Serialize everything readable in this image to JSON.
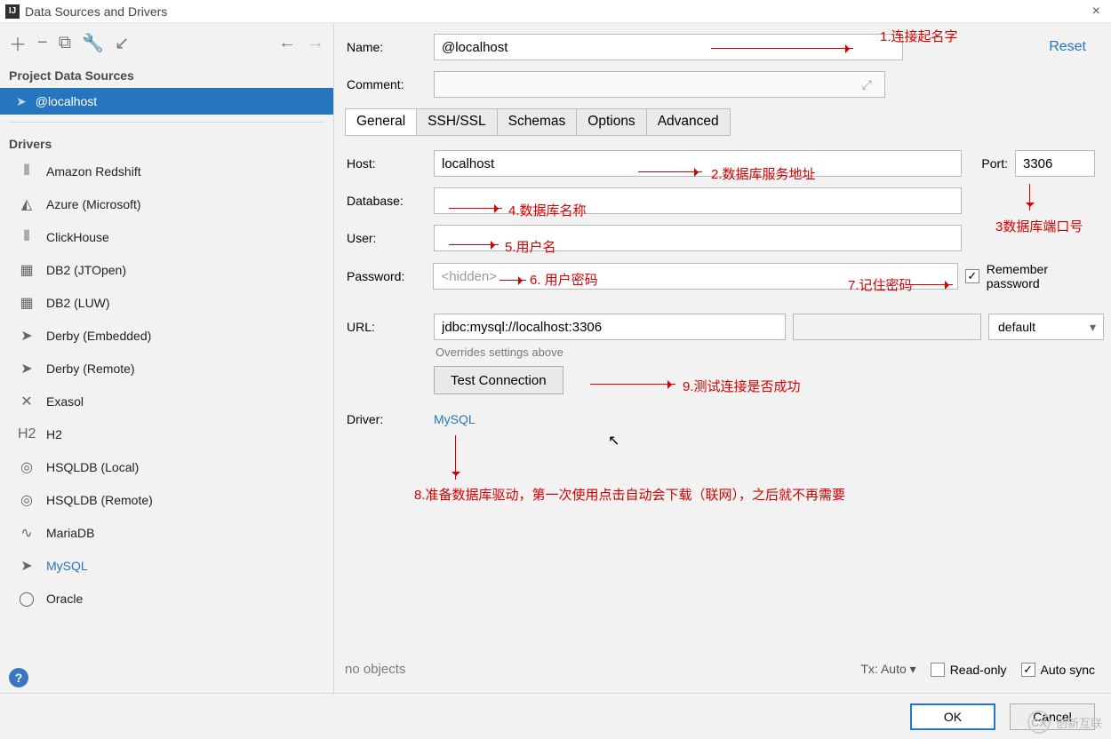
{
  "window": {
    "title": "Data Sources and Drivers",
    "close": "×"
  },
  "sidebar": {
    "project_header": "Project Data Sources",
    "selected_ds": "@localhost",
    "drivers_header": "Drivers",
    "drivers": [
      {
        "name": "Amazon Redshift",
        "icon": "⦀"
      },
      {
        "name": "Azure (Microsoft)",
        "icon": "◭"
      },
      {
        "name": "ClickHouse",
        "icon": "⦀"
      },
      {
        "name": "DB2 (JTOpen)",
        "icon": "▦"
      },
      {
        "name": "DB2 (LUW)",
        "icon": "▦"
      },
      {
        "name": "Derby (Embedded)",
        "icon": "➤"
      },
      {
        "name": "Derby (Remote)",
        "icon": "➤"
      },
      {
        "name": "Exasol",
        "icon": "✕"
      },
      {
        "name": "H2",
        "icon": "H2"
      },
      {
        "name": "HSQLDB (Local)",
        "icon": "◎"
      },
      {
        "name": "HSQLDB (Remote)",
        "icon": "◎"
      },
      {
        "name": "MariaDB",
        "icon": "∿"
      },
      {
        "name": "MySQL",
        "icon": "➤",
        "selected": true
      },
      {
        "name": "Oracle",
        "icon": "◯"
      }
    ]
  },
  "form": {
    "labels": {
      "name": "Name:",
      "comment": "Comment:",
      "host": "Host:",
      "port": "Port:",
      "database": "Database:",
      "user": "User:",
      "password": "Password:",
      "url": "URL:",
      "driver": "Driver:"
    },
    "name_value": "@localhost",
    "reset": "Reset",
    "tabs": [
      "General",
      "SSH/SSL",
      "Schemas",
      "Options",
      "Advanced"
    ],
    "host_value": "localhost",
    "port_value": "3306",
    "database_value": "",
    "user_value": "",
    "password_placeholder": "<hidden>",
    "remember_label": "Remember password",
    "url_value": "jdbc:mysql://localhost:3306",
    "url_mode": "default",
    "url_hint": "Overrides settings above",
    "test_btn": "Test Connection",
    "driver_link": "MySQL",
    "no_objects": "no objects",
    "tx_label": "Tx:",
    "tx_value": "Auto",
    "readonly_label": "Read-only",
    "autosync_label": "Auto sync"
  },
  "dialog": {
    "ok": "OK",
    "cancel": "Cancel"
  },
  "watermark": "创新互联",
  "annotations": {
    "a1": "1.连接起名字",
    "a2": "2.数据库服务地址",
    "a3": "3数据库端口号",
    "a4": "4.数据库名称",
    "a5": "5.用户名",
    "a6": "6. 用户密码",
    "a7": "7.记住密码",
    "a8": "8.准备数据库驱动，第一次使用点击自动会下载（联网），之后就不再需要",
    "a9": "9.测试连接是否成功"
  }
}
